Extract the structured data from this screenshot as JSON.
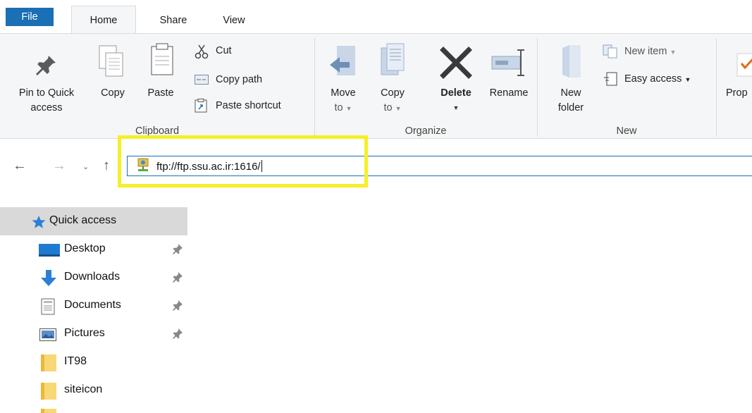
{
  "tabs": {
    "file": "File",
    "home": "Home",
    "share": "Share",
    "view": "View"
  },
  "ribbon": {
    "clipboard": {
      "pin_line1": "Pin to Quick",
      "pin_line2": "access",
      "copy": "Copy",
      "paste": "Paste",
      "cut": "Cut",
      "copy_path": "Copy path",
      "paste_shortcut": "Paste shortcut",
      "caption": "Clipboard"
    },
    "organize": {
      "move_line1": "Move",
      "move_line2": "to",
      "copy_line1": "Copy",
      "copy_line2": "to",
      "delete": "Delete",
      "rename": "Rename",
      "caption": "Organize"
    },
    "new": {
      "folder_line1": "New",
      "folder_line2": "folder",
      "new_item": "New item",
      "easy_access": "Easy access",
      "caption": "New"
    },
    "open": {
      "properties_partial": "Prop"
    }
  },
  "address": {
    "value": "ftp://ftp.ssu.ac.ir:1616/"
  },
  "nav": {
    "quick_access": "Quick access",
    "items": [
      {
        "label": "Desktop"
      },
      {
        "label": "Downloads"
      },
      {
        "label": "Documents"
      },
      {
        "label": "Pictures"
      },
      {
        "label": "IT98"
      },
      {
        "label": "siteicon"
      }
    ]
  },
  "colors": {
    "accent": "#1a6fb5",
    "highlight": "#f5ef2a",
    "folder": "#f8d775",
    "selected": "#d9d9d9"
  }
}
